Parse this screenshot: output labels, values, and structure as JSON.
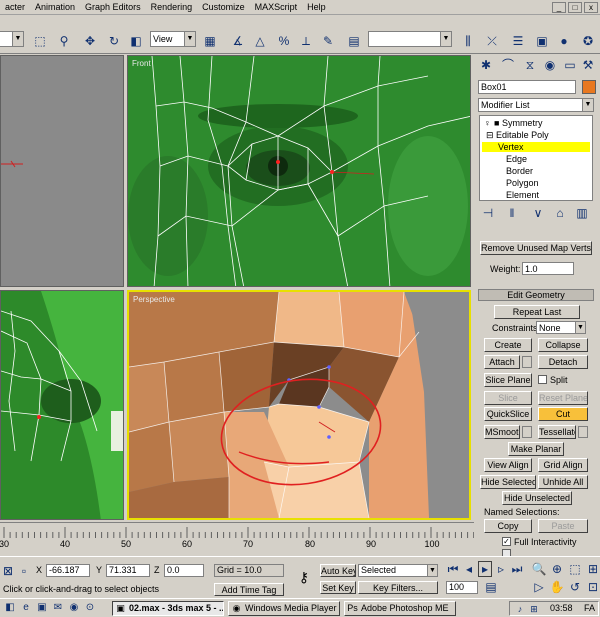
{
  "menu": [
    "acter",
    "Animation",
    "Graph Editors",
    "Rendering",
    "Customize",
    "MAXScript",
    "Help"
  ],
  "window_buttons": [
    "_",
    "□",
    "x"
  ],
  "toolbar": {
    "view_dropdown": "View",
    "selection_set": ""
  },
  "viewports": {
    "front_label": "Front",
    "perspective_label": "Perspective"
  },
  "panel": {
    "object_name": "Box01",
    "modifier_list": "Modifier List",
    "stack": [
      "Symmetry",
      "Editable Poly",
      "Vertex",
      "Edge",
      "Border",
      "Polygon",
      "Element"
    ],
    "remove_unused": "Remove Unused Map Verts",
    "weight_label": "Weight:",
    "weight_value": "1.0",
    "edit_geometry": "Edit Geometry",
    "repeat_last": "Repeat Last",
    "constraints_label": "Constraints:",
    "constraints_value": "None",
    "create": "Create",
    "collapse": "Collapse",
    "attach": "Attach",
    "detach": "Detach",
    "slice_plane": "Slice Plane",
    "split": "Split",
    "slice": "Slice",
    "reset_plane": "Reset Plane",
    "quickslice": "QuickSlice",
    "cut": "Cut",
    "msmooth": "MSmooth",
    "tessellate": "Tessellate",
    "make_planar": "Make Planar",
    "view_align": "View Align",
    "grid_align": "Grid Align",
    "hide_selected": "Hide Selected",
    "unhide_all": "Unhide All",
    "hide_unselected": "Hide Unselected",
    "named_selections": "Named Selections:",
    "copy": "Copy",
    "paste": "Paste",
    "full_interactivity": "Full Interactivity"
  },
  "timeline": {
    "ticks": [
      "30",
      "40",
      "50",
      "60",
      "70",
      "80",
      "90",
      "100"
    ]
  },
  "status": {
    "x_label": "X",
    "x_value": "-66.187",
    "y_label": "Y",
    "y_value": "71.331",
    "z_label": "Z",
    "z_value": "0.0",
    "grid": "Grid = 10.0",
    "auto_key": "Auto Key",
    "set_key": "Set Key",
    "selected": "Selected",
    "key_filters": "Key Filters...",
    "prompt": "Click or click-and-drag to select objects",
    "add_time_tag": "Add Time Tag",
    "frame": "100"
  },
  "taskbar": {
    "tasks": [
      "02.max - 3ds max 5 - ...",
      "Windows Media Player",
      "Adobe Photoshop ME"
    ],
    "clock": "03:58",
    "lang": "FA"
  },
  "colors": {
    "active_button": "#f8c03a",
    "selected_stack_item": "#ffff00",
    "annotation": "#e02020",
    "viewport_front": "#2e8b2e",
    "mesh_wire": "#ffffff"
  }
}
